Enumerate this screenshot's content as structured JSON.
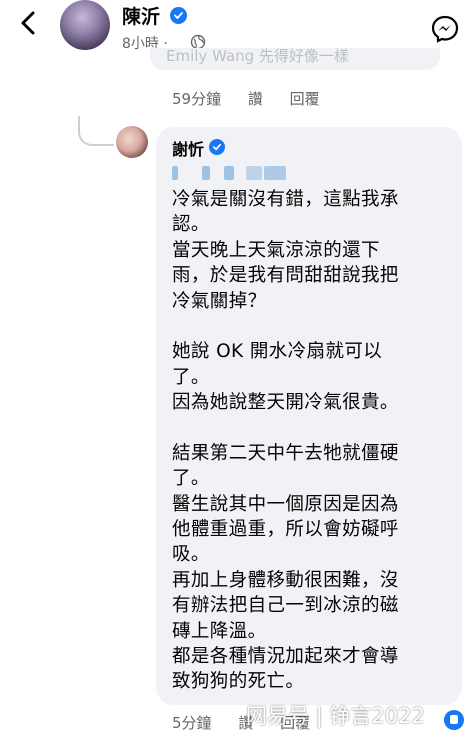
{
  "header": {
    "page_name": "陳沂",
    "post_time": "8小時 ·"
  },
  "previous_reply": {
    "partial_text": "Emily Wang 先得好像一樣"
  },
  "previous_meta": {
    "time": "59分鐘",
    "like": "讚",
    "reply": "回覆"
  },
  "comment": {
    "author": "謝忻",
    "lines": [
      "冷氣是關沒有錯，這點我承",
      "認。",
      "當天晚上天氣涼涼的還下",
      "雨，於是我有問甜甜說我把",
      "冷氣關掉？",
      "",
      "她說 OK 開水冷扇就可以",
      "了。",
      "因為她說整天開冷氣很貴。",
      "",
      "結果第二天中午去牠就僵硬",
      "了。",
      "醫生說其中一個原因是因為",
      "他體重過重，所以會妨礙呼",
      "吸。",
      "再加上身體移動很困難，沒",
      "有辦法把自己一到冰涼的磁",
      "磚上降溫。",
      "都是各種情況加起來才會導",
      "致狗狗的死亡。"
    ]
  },
  "comment_meta": {
    "time": "5分鐘",
    "like": "讚",
    "reply": "回覆"
  },
  "watermark": "网易号 | 铮言2022",
  "colors": {
    "verified": "#1877f2",
    "bubble": "#f0f2f5",
    "meta_text": "#65676b"
  }
}
